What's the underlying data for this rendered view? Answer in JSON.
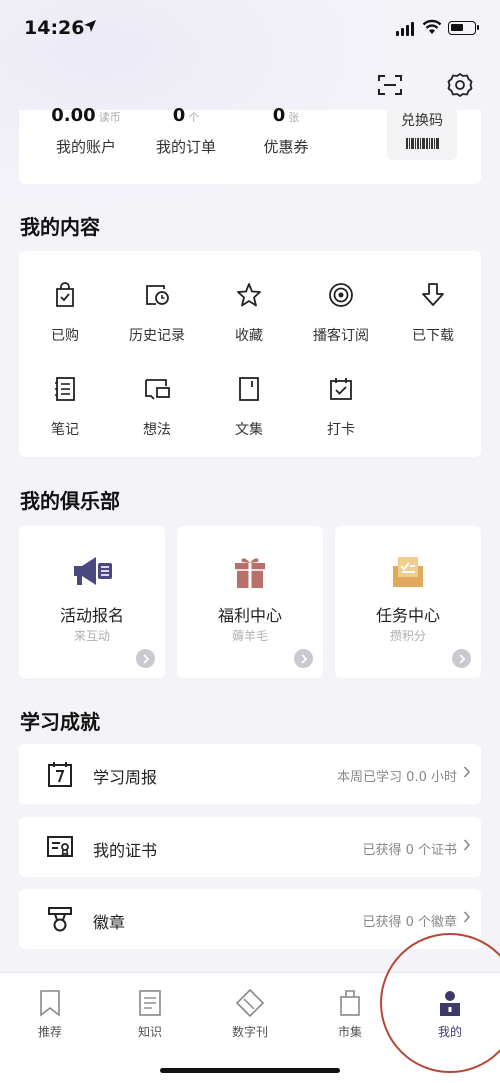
{
  "status_bar": {
    "time": "14:26"
  },
  "account": {
    "items": [
      {
        "value": "0.00",
        "unit": "读币",
        "label": "我的账户"
      },
      {
        "value": "0",
        "unit": "个",
        "label": "我的订单"
      },
      {
        "value": "0",
        "unit": "张",
        "label": "优惠券"
      }
    ],
    "redeem_label": "兑换码"
  },
  "my_content": {
    "title": "我的内容",
    "items": [
      {
        "label": "已购",
        "icon": "bag-check-icon"
      },
      {
        "label": "历史记录",
        "icon": "history-icon"
      },
      {
        "label": "收藏",
        "icon": "star-icon"
      },
      {
        "label": "播客订阅",
        "icon": "podcast-icon"
      },
      {
        "label": "已下载",
        "icon": "download-icon"
      },
      {
        "label": "笔记",
        "icon": "notes-icon"
      },
      {
        "label": "想法",
        "icon": "thought-icon"
      },
      {
        "label": "文集",
        "icon": "collection-icon"
      },
      {
        "label": "打卡",
        "icon": "checkin-icon"
      }
    ]
  },
  "club": {
    "title": "我的俱乐部",
    "items": [
      {
        "name": "活动报名",
        "sub": "来互动",
        "icon": "megaphone-icon",
        "color": "#4b4880"
      },
      {
        "name": "福利中心",
        "sub": "薅羊毛",
        "icon": "gift-icon",
        "color": "#b8706a"
      },
      {
        "name": "任务中心",
        "sub": "攒积分",
        "icon": "task-envelope-icon",
        "color": "#e0aa5e"
      }
    ]
  },
  "achievements": {
    "title": "学习成就",
    "rows": [
      {
        "label": "学习周报",
        "value": "本周已学习 0.0 小时",
        "icon": "calendar-7-icon"
      },
      {
        "label": "我的证书",
        "value": "已获得 0 个证书",
        "icon": "certificate-icon"
      },
      {
        "label": "徽章",
        "value": "已获得 0 个徽章",
        "icon": "badge-medal-icon"
      }
    ]
  },
  "tabbar": {
    "tabs": [
      {
        "label": "推荐",
        "icon": "bookmark-icon"
      },
      {
        "label": "知识",
        "icon": "document-icon"
      },
      {
        "label": "数字刊",
        "icon": "diamond-icon"
      },
      {
        "label": "市集",
        "icon": "shopping-bag-icon"
      },
      {
        "label": "我的",
        "icon": "profile-icon",
        "active": true
      }
    ]
  },
  "colors": {
    "accent": "#3d3a6b",
    "annotation": "#b5473a"
  }
}
